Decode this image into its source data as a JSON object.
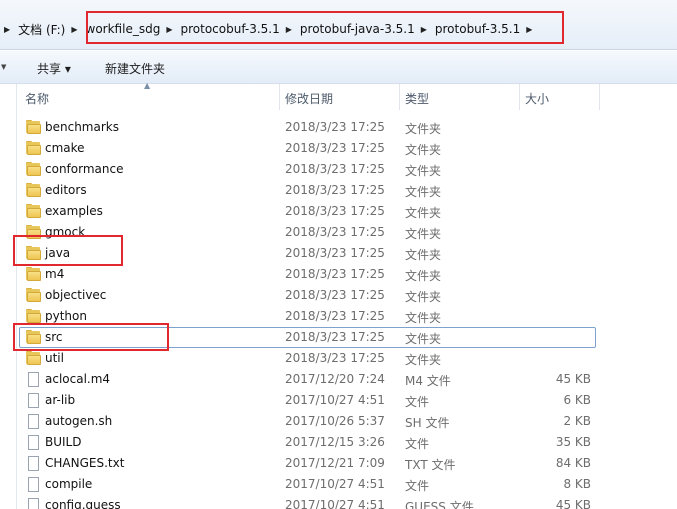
{
  "address": {
    "crumbs": [
      "文档 (F:)",
      "workfile_sdg",
      "protocobuf-3.5.1",
      "protobuf-java-3.5.1",
      "protobuf-3.5.1"
    ]
  },
  "toolbar": {
    "share_label": "共享 ▾",
    "new_folder_label": "新建文件夹"
  },
  "columns": {
    "name": "名称",
    "date": "修改日期",
    "type": "类型",
    "size": "大小"
  },
  "files": [
    {
      "name": "benchmarks",
      "date": "2018/3/23 17:25",
      "type": "文件夹",
      "size": "",
      "icon": "folder-icon"
    },
    {
      "name": "cmake",
      "date": "2018/3/23 17:25",
      "type": "文件夹",
      "size": "",
      "icon": "folder-icon"
    },
    {
      "name": "conformance",
      "date": "2018/3/23 17:25",
      "type": "文件夹",
      "size": "",
      "icon": "folder-icon"
    },
    {
      "name": "editors",
      "date": "2018/3/23 17:25",
      "type": "文件夹",
      "size": "",
      "icon": "folder-icon"
    },
    {
      "name": "examples",
      "date": "2018/3/23 17:25",
      "type": "文件夹",
      "size": "",
      "icon": "folder-icon"
    },
    {
      "name": "gmock",
      "date": "2018/3/23 17:25",
      "type": "文件夹",
      "size": "",
      "icon": "folder-icon"
    },
    {
      "name": "java",
      "date": "2018/3/23 17:25",
      "type": "文件夹",
      "size": "",
      "icon": "folder-icon"
    },
    {
      "name": "m4",
      "date": "2018/3/23 17:25",
      "type": "文件夹",
      "size": "",
      "icon": "folder-icon"
    },
    {
      "name": "objectivec",
      "date": "2018/3/23 17:25",
      "type": "文件夹",
      "size": "",
      "icon": "folder-icon"
    },
    {
      "name": "python",
      "date": "2018/3/23 17:25",
      "type": "文件夹",
      "size": "",
      "icon": "folder-icon"
    },
    {
      "name": "src",
      "date": "2018/3/23 17:25",
      "type": "文件夹",
      "size": "",
      "icon": "folder-icon",
      "selected": true
    },
    {
      "name": "util",
      "date": "2018/3/23 17:25",
      "type": "文件夹",
      "size": "",
      "icon": "folder-icon"
    },
    {
      "name": "aclocal.m4",
      "date": "2017/12/20 7:24",
      "type": "M4 文件",
      "size": "45 KB",
      "icon": "file-icon"
    },
    {
      "name": "ar-lib",
      "date": "2017/10/27 4:51",
      "type": "文件",
      "size": "6 KB",
      "icon": "file-icon"
    },
    {
      "name": "autogen.sh",
      "date": "2017/10/26 5:37",
      "type": "SH 文件",
      "size": "2 KB",
      "icon": "file-icon"
    },
    {
      "name": "BUILD",
      "date": "2017/12/15 3:26",
      "type": "文件",
      "size": "35 KB",
      "icon": "file-icon"
    },
    {
      "name": "CHANGES.txt",
      "date": "2017/12/21 7:09",
      "type": "TXT 文件",
      "size": "84 KB",
      "icon": "file-icon"
    },
    {
      "name": "compile",
      "date": "2017/10/27 4:51",
      "type": "文件",
      "size": "8 KB",
      "icon": "file-icon"
    },
    {
      "name": "config.guess",
      "date": "2017/10/27 4:51",
      "type": "GUESS 文件",
      "size": "45 KB",
      "icon": "file-icon"
    }
  ],
  "colors": {
    "annotation_red": "#e0282e",
    "selection_border": "#7da2ce"
  }
}
